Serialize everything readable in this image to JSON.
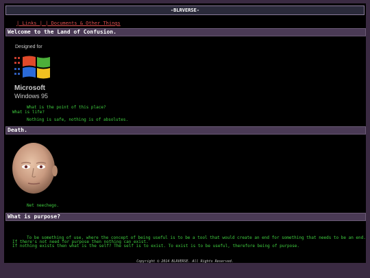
{
  "site": {
    "title": "-BLRVERSE-"
  },
  "nav": {
    "links": "| Links | | Documents & Other Things"
  },
  "sections": [
    {
      "header": "Welcome to the Land of Confusion.",
      "logo": {
        "line1": "Designed for",
        "line2": "Microsoft",
        "line3": "Windows 95"
      },
      "text1": "What is the point of this place?",
      "text2": "What is life?",
      "text3": "Nothing is safe, nothing is of absolutes."
    },
    {
      "header": "Death.",
      "caption": "Net neechego."
    },
    {
      "header": "What is purpose?",
      "text1": "To be something of use, where the concept of being useful is to be a tool that would create an end for something that needs to be an end.",
      "text2": "If there's not need for purpose then nothing can exist.",
      "text3": "If nothing exists then what is the self? The self is to exist. To exist is to be useful, therefore being of purpose."
    }
  ],
  "footer": {
    "copyright": "Copyright © 2014 BLRVERSE. All Rights Reserved."
  }
}
